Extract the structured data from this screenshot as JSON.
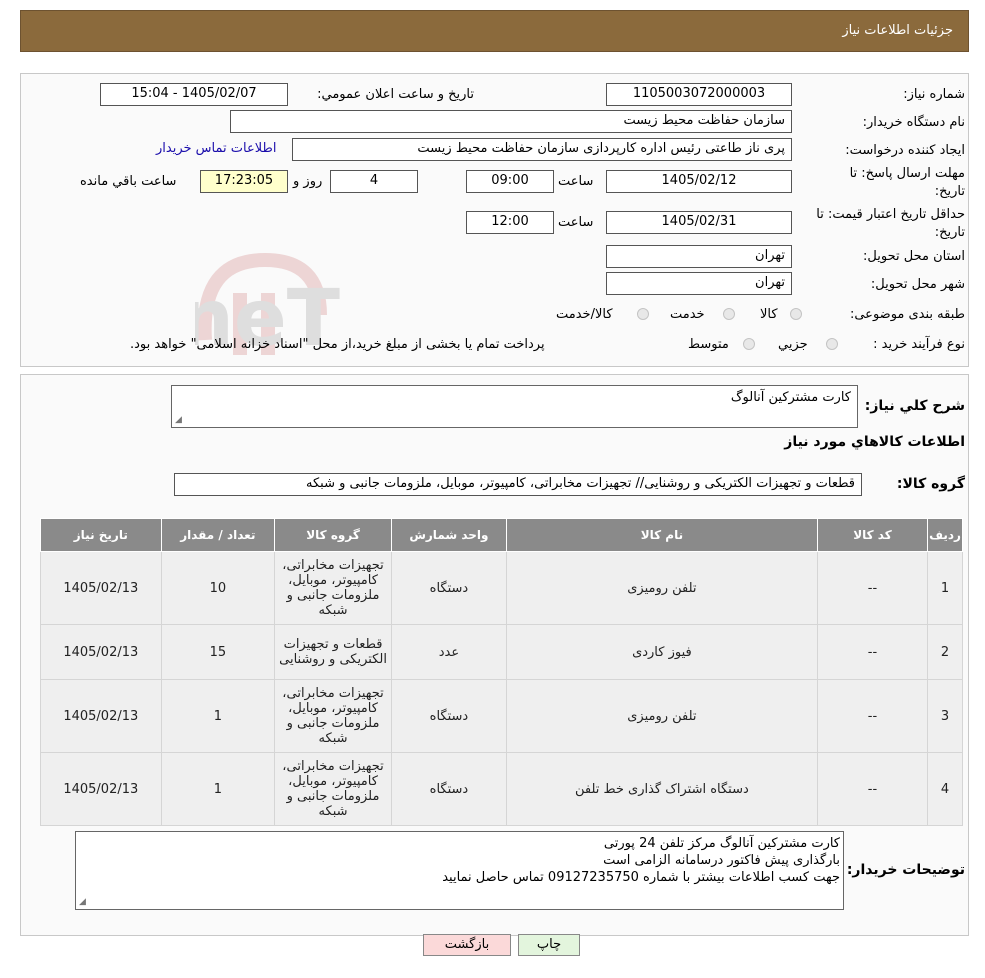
{
  "header": {
    "title": "جزئیات اطلاعات نیاز"
  },
  "fields": {
    "need_number_label": "شماره نیاز:",
    "need_number": "1105003072000003",
    "announce_label": "تاریخ و ساعت اعلان عمومي:",
    "announce_value": "1405/02/07 - 15:04",
    "buyer_org_label": "نام دستگاه خریدار:",
    "buyer_org": "سازمان حفاظت محیط زیست",
    "requester_label": "ایجاد کننده درخواست:",
    "requester": "پری ناز طاعتی رئیس اداره کارپردازی سازمان حفاظت محیط زیست",
    "contact_link": "اطلاعات تماس خریدار",
    "deadline_label_1": "مهلت ارسال پاسخ: تا",
    "deadline_label_2": "تاریخ:",
    "deadline_date": "1405/02/12",
    "time_label": "ساعت",
    "deadline_time": "09:00",
    "days_value": "4",
    "days_label": "روز و",
    "remaining_time": "17:23:05",
    "remaining_label": "ساعت باقي مانده",
    "validity_label_1": "حداقل تاریخ اعتبار قیمت: تا",
    "validity_label_2": "تاریخ:",
    "validity_date": "1405/02/31",
    "validity_time": "12:00",
    "province_label": "استان محل تحویل:",
    "province": "تهران",
    "city_label": "شهر محل تحویل:",
    "city": "تهران",
    "category_label": "طبقه بندی موضوعی:",
    "category_options": [
      "کالا",
      "خدمت",
      "کالا/خدمت"
    ],
    "process_label": "نوع فرآیند خرید :",
    "process_options": [
      "جزیي",
      "متوسط"
    ],
    "process_note": "پرداخت تمام یا بخشی از مبلغ خرید،از محل \"اسناد خزانه اسلامی\" خواهد بود."
  },
  "watermark": {
    "text": "AriaTender.neT"
  },
  "summary": {
    "label": "شرح کلي نیاز:",
    "value": "کارت مشترکین آنالوگ",
    "goods_info_title": "اطلاعات کالاهاي مورد نیاز",
    "goods_group_label": "گروه کالا:",
    "goods_group_value": "قطعات و تجهیزات الکتریکی و روشنایی// تجهیزات مخابراتی، کامپیوتر، موبایل، ملزومات جانبی و شبکه"
  },
  "table": {
    "headers": [
      "ردیف",
      "کد کالا",
      "نام کالا",
      "واحد شمارش",
      "گروه کالا",
      "تعداد / مقدار",
      "تاریخ نیاز"
    ],
    "rows": [
      [
        "1",
        "--",
        "تلفن رومیزی",
        "دستگاه",
        "تجهیزات مخابراتی، کامپیوتر، موبایل، ملزومات جانبی و شبکه",
        "10",
        "1405/02/13"
      ],
      [
        "2",
        "--",
        "فیوز کاردی",
        "عدد",
        "قطعات و تجهیزات الکتریکی و روشنایی",
        "15",
        "1405/02/13"
      ],
      [
        "3",
        "--",
        "تلفن رومیزی",
        "دستگاه",
        "تجهیزات مخابراتی، کامپیوتر، موبایل، ملزومات جانبی و شبکه",
        "1",
        "1405/02/13"
      ],
      [
        "4",
        "--",
        "دستگاه اشتراک گذاری خط تلفن",
        "دستگاه",
        "تجهیزات مخابراتی، کامپیوتر، موبایل، ملزومات جانبی و شبکه",
        "1",
        "1405/02/13"
      ]
    ]
  },
  "buyer_notes": {
    "label": "توضیحات خریدار:",
    "lines": [
      "کارت مشترکین آنالوگ مرکز تلفن 24 پورتی",
      "بارگذاری پیش فاکتور درسامانه الزامی است",
      "جهت کسب اطلاعات بیشتر با شماره 09127235750 تماس حاصل نمایید"
    ]
  },
  "buttons": {
    "print": "چاپ",
    "back": "بازگشت"
  },
  "colors": {
    "header_bg": "#8b6a3c",
    "table_header_bg": "#8a8a8a",
    "back_btn_bg": "#fbd9d9",
    "print_btn_bg": "#e3f5dd",
    "timer_bg": "#ffffcc"
  }
}
